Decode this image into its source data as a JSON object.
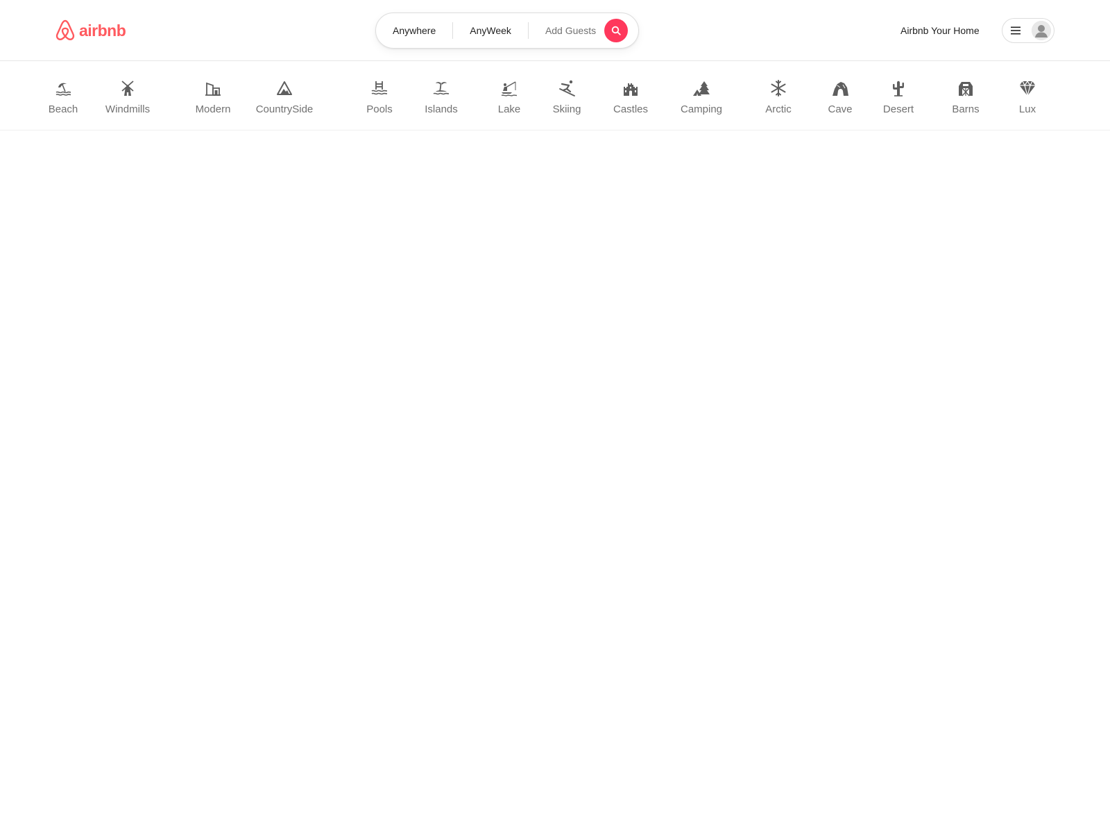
{
  "brand": {
    "name": "airbnb",
    "color": "#FF5A5F"
  },
  "search": {
    "where": "Anywhere",
    "when": "AnyWeek",
    "guests": "Add Guests",
    "button_color": "#FF385C",
    "button_icon": "search-icon"
  },
  "header": {
    "host_link": "Airbnb Your Home",
    "menu_icon": "hamburger-icon",
    "avatar_icon": "user-avatar-icon"
  },
  "categories": [
    {
      "label": "Beach",
      "icon": "beach-umbrella-icon"
    },
    {
      "label": "Windmills",
      "icon": "windmill-icon"
    },
    {
      "label": "Modern",
      "icon": "modern-house-icon"
    },
    {
      "label": "CountrySide",
      "icon": "mountain-icon"
    },
    {
      "label": "Pools",
      "icon": "pool-ladder-icon"
    },
    {
      "label": "Islands",
      "icon": "island-palm-icon"
    },
    {
      "label": "Lake",
      "icon": "lake-fishing-icon"
    },
    {
      "label": "Skiing",
      "icon": "skier-icon"
    },
    {
      "label": "Castles",
      "icon": "castle-icon"
    },
    {
      "label": "Camping",
      "icon": "camping-tent-icon"
    },
    {
      "label": "Arctic",
      "icon": "snowflake-icon"
    },
    {
      "label": "Cave",
      "icon": "cave-icon"
    },
    {
      "label": "Desert",
      "icon": "cactus-icon"
    },
    {
      "label": "Barns",
      "icon": "barn-icon"
    },
    {
      "label": "Lux",
      "icon": "diamond-icon"
    }
  ],
  "colors": {
    "category_icon": "#5e5e5e",
    "category_label": "#717171"
  }
}
